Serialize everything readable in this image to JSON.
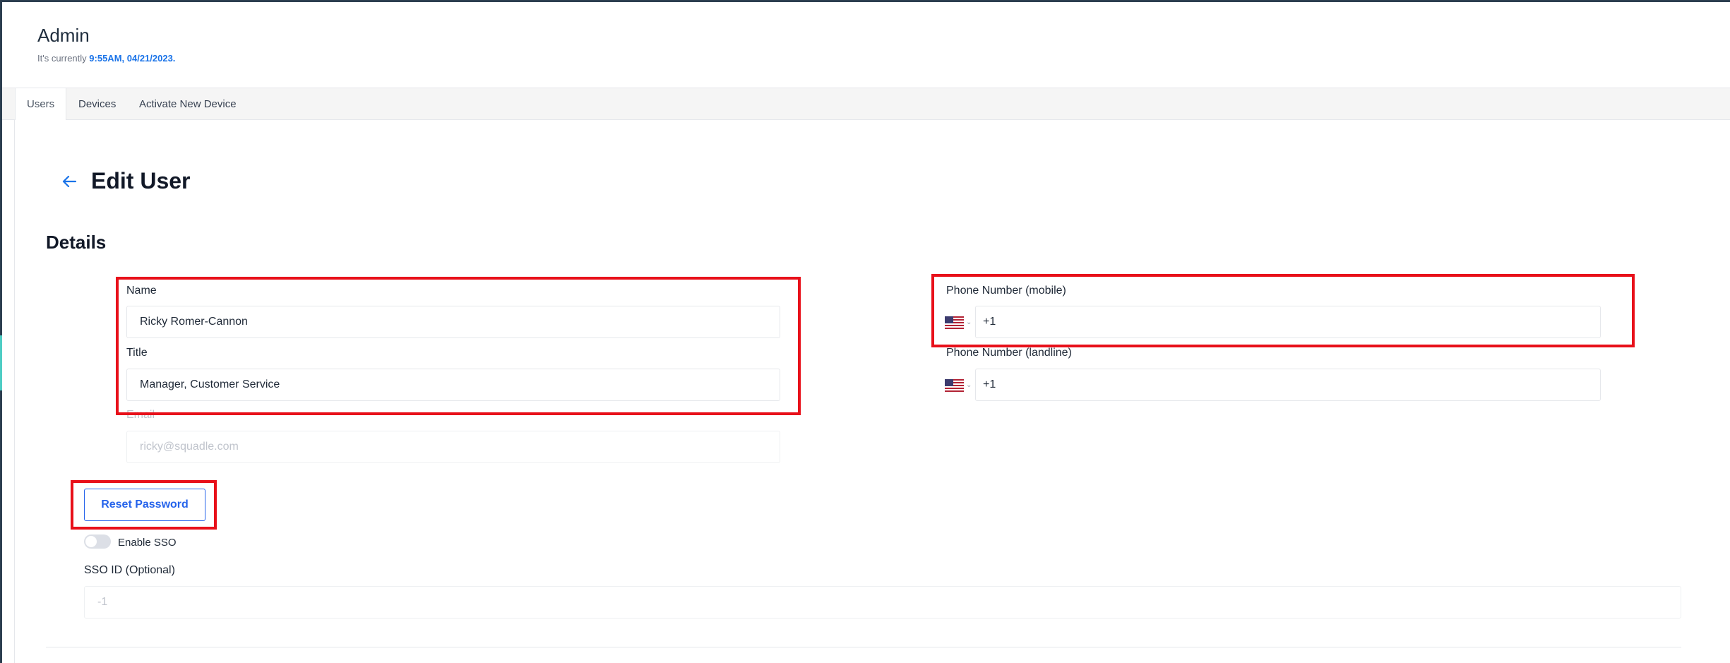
{
  "header": {
    "title": "Admin",
    "time_prefix": "It's currently ",
    "time_value": "9:55AM, 04/21/2023."
  },
  "tabs": [
    {
      "label": "Users",
      "active": true
    },
    {
      "label": "Devices",
      "active": false
    },
    {
      "label": "Activate New Device",
      "active": false
    }
  ],
  "page": {
    "title": "Edit User",
    "back_icon": "arrow-left-icon",
    "section_title": "Details"
  },
  "form": {
    "name_label": "Name",
    "name_value": "Ricky Romer-Cannon",
    "title_label": "Title",
    "title_value": "Manager, Customer Service",
    "email_label": "Email",
    "email_placeholder": "ricky@squadle.com",
    "mobile_label": "Phone Number (mobile)",
    "mobile_value": "+1",
    "landline_label": "Phone Number (landline)",
    "landline_value": "+1",
    "reset_password_label": "Reset Password",
    "sso_toggle_label": "Enable SSO",
    "sso_enabled": false,
    "sso_id_label": "SSO ID (Optional)",
    "sso_id_placeholder": "-1",
    "country_flag": "us-flag-icon"
  },
  "colors": {
    "accent": "#2563eb",
    "highlight": "#e8101a",
    "time": "#1a73e8"
  }
}
